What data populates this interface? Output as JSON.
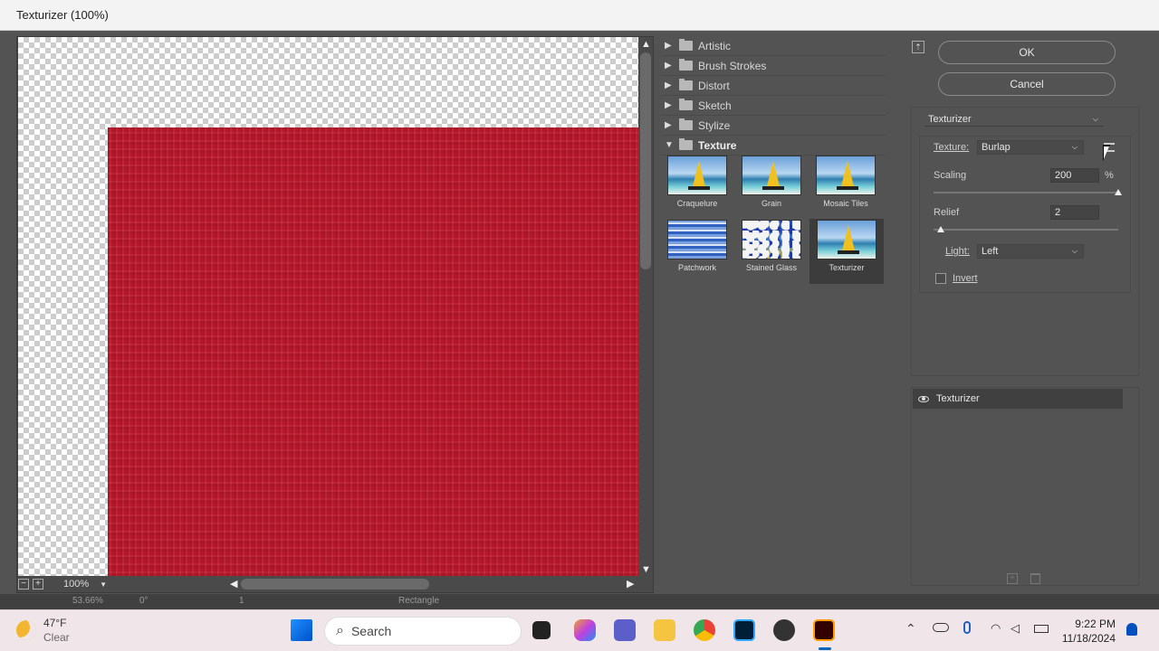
{
  "window": {
    "title": "Texturizer (100%)"
  },
  "preview": {
    "zoom": "100%",
    "zoom_minus": "−",
    "zoom_plus": "+"
  },
  "categories": [
    {
      "label": "Artistic",
      "expanded": false
    },
    {
      "label": "Brush Strokes",
      "expanded": false
    },
    {
      "label": "Distort",
      "expanded": false
    },
    {
      "label": "Sketch",
      "expanded": false
    },
    {
      "label": "Stylize",
      "expanded": false
    },
    {
      "label": "Texture",
      "expanded": true
    }
  ],
  "texture_filters": [
    {
      "label": "Craquelure"
    },
    {
      "label": "Grain"
    },
    {
      "label": "Mosaic Tiles"
    },
    {
      "label": "Patchwork"
    },
    {
      "label": "Stained Glass"
    },
    {
      "label": "Texturizer",
      "selected": true
    }
  ],
  "buttons": {
    "ok": "OK",
    "cancel": "Cancel"
  },
  "filter_select": {
    "value": "Texturizer"
  },
  "settings": {
    "texture_label": "Texture:",
    "texture_value": "Burlap",
    "scaling_label": "Scaling",
    "scaling_value": "200",
    "scaling_unit": "%",
    "scaling_fraction": 1.0,
    "relief_label": "Relief",
    "relief_value": "2",
    "relief_fraction": 0.04,
    "light_label": "Light:",
    "light_value": "Left",
    "invert_label": "Invert",
    "invert_checked": false
  },
  "effect_layers": [
    {
      "label": "Texturizer",
      "visible": true
    }
  ],
  "status_bar": {
    "zoom": "53.66%",
    "angle": "0°",
    "artboard": "1",
    "tool": "Rectangle"
  },
  "taskbar": {
    "weather_temp": "47°F",
    "weather_cond": "Clear",
    "search_placeholder": "Search",
    "time": "9:22 PM",
    "date": "11/18/2024"
  },
  "colors": {
    "accent_red": "#c41a2e",
    "dialog_bg": "#535353"
  }
}
